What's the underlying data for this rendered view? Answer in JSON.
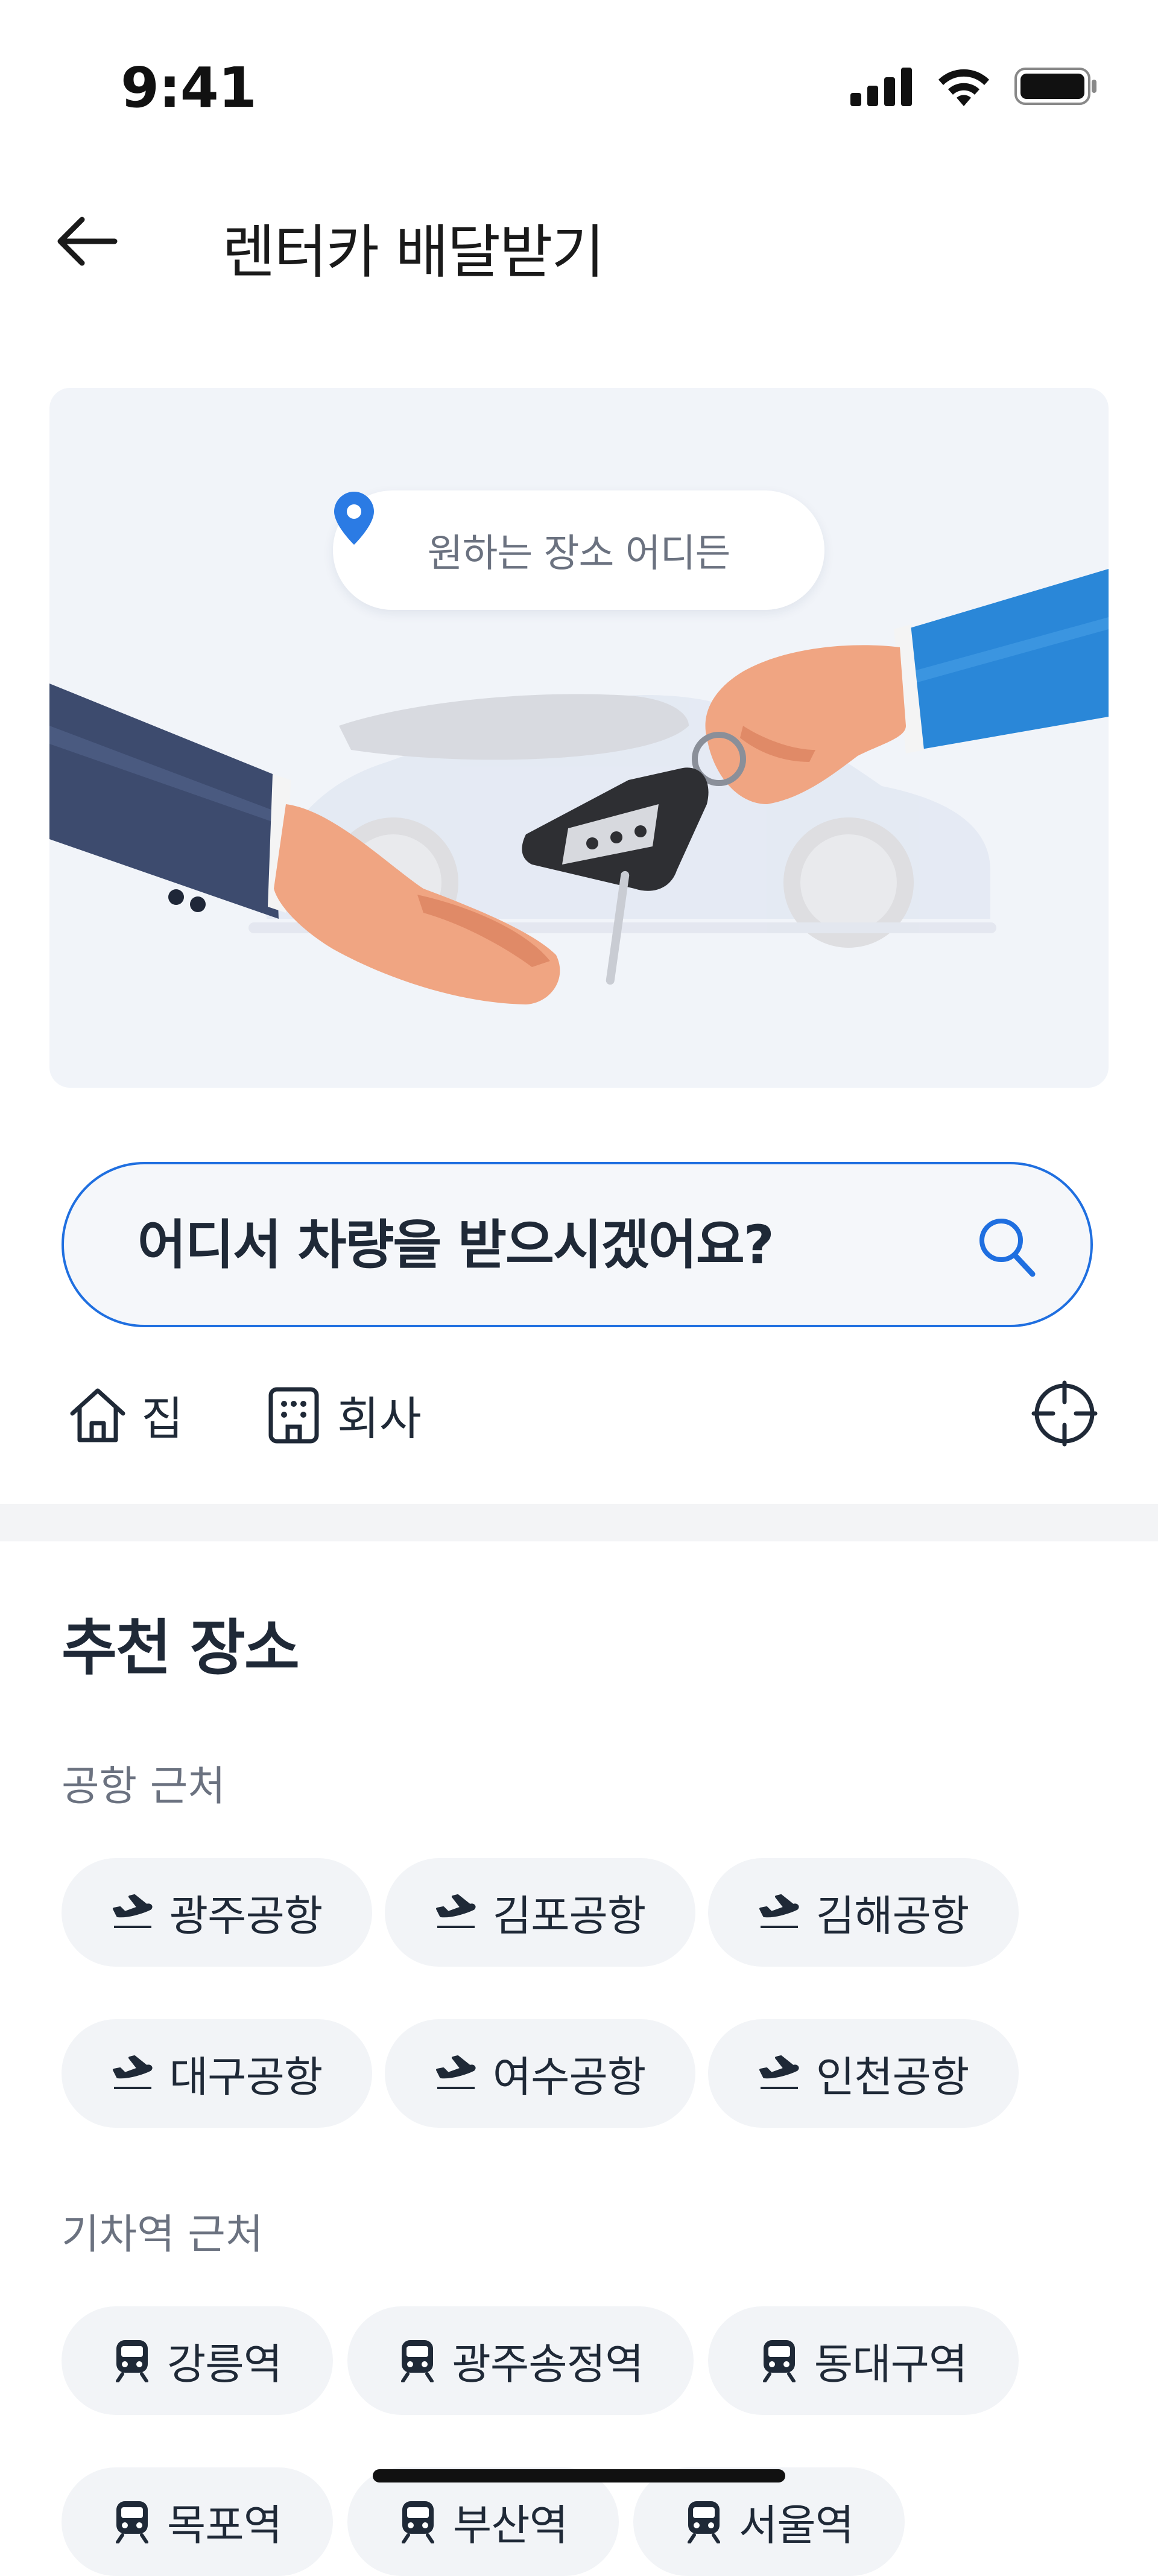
{
  "status_bar": {
    "time": "9:41"
  },
  "header": {
    "title": "렌터카 배달받기"
  },
  "hero": {
    "bubble_text": "원하는 장소 어디든"
  },
  "search": {
    "placeholder": "어디서 차량을 받으시겠어요?"
  },
  "quick_places": [
    {
      "label": "집",
      "icon": "home-icon"
    },
    {
      "label": "회사",
      "icon": "building-icon"
    }
  ],
  "recommended": {
    "title": "추천 장소",
    "groups": [
      {
        "label": "공항 근처",
        "icon": "airplane-icon",
        "items": [
          "광주공항",
          "김포공항",
          "김해공항",
          "대구공항",
          "여수공항",
          "인천공항"
        ]
      },
      {
        "label": "기차역 근처",
        "icon": "train-icon",
        "items": [
          "강릉역",
          "광주송정역",
          "동대구역",
          "목포역",
          "부산역",
          "서울역"
        ]
      }
    ]
  },
  "colors": {
    "accent": "#1f6fe0",
    "chip_bg": "#f2f4f7",
    "hero_bg": "#f1f4f9"
  }
}
